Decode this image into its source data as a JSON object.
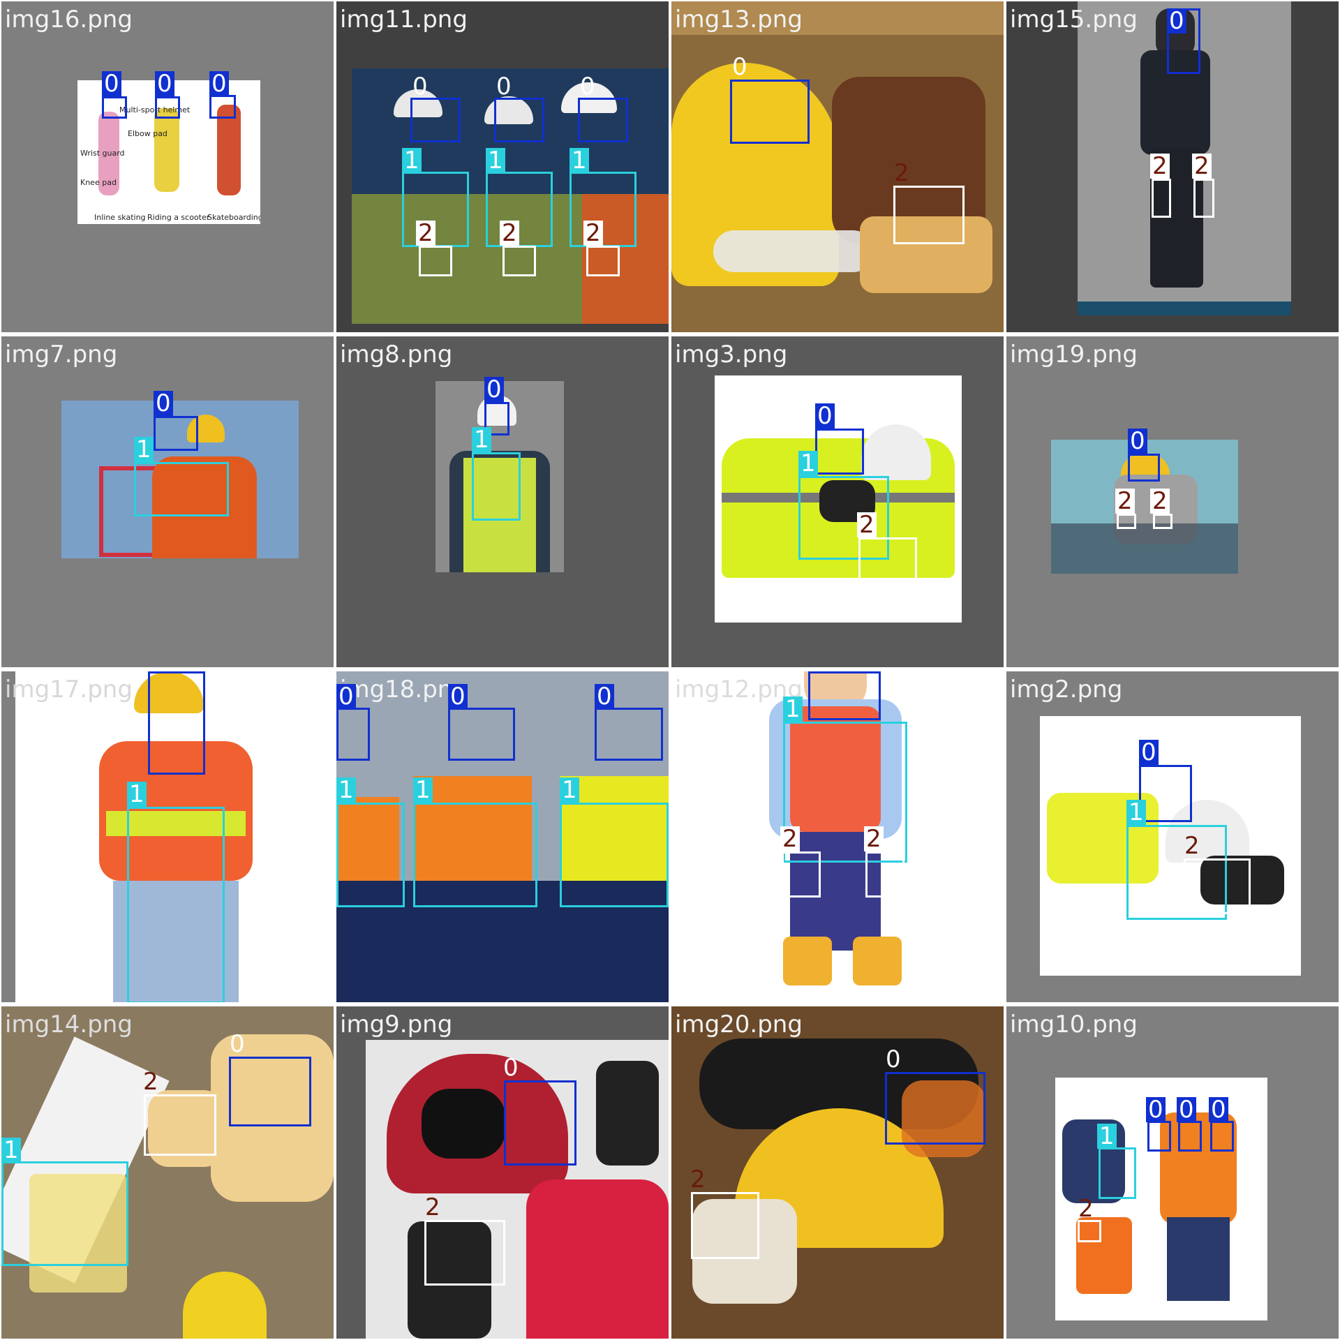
{
  "grid_bg": "#ffffff",
  "class_colors": {
    "0": "#1030d0",
    "1": "#2ad0de",
    "2": "#ffffff"
  },
  "tiles": [
    {
      "file": "img16.png",
      "bg": "#7f7f7f",
      "photo_color": "#ffffff",
      "figure_labels": [
        "Multi-sport helmet",
        "Elbow pad",
        "Wrist guard",
        "Knee pad",
        "Inline skating",
        "Riding a scooter",
        "Skateboarding"
      ],
      "boxes": [
        {
          "cls": "0"
        },
        {
          "cls": "0"
        },
        {
          "cls": "0"
        }
      ]
    },
    {
      "file": "img11.png",
      "bg": "#404040",
      "photo_color": "#1f3a5c",
      "boxes": [
        {
          "cls": "0"
        },
        {
          "cls": "0"
        },
        {
          "cls": "0"
        },
        {
          "cls": "1"
        },
        {
          "cls": "1"
        },
        {
          "cls": "1"
        },
        {
          "cls": "2"
        },
        {
          "cls": "2"
        },
        {
          "cls": "2"
        }
      ]
    },
    {
      "file": "img13.png",
      "bg": "#b08a50",
      "photo_color": "#8a6a3a",
      "boxes": [
        {
          "cls": "0"
        },
        {
          "cls": "2"
        }
      ]
    },
    {
      "file": "img15.png",
      "bg": "#404040",
      "photo_color": "#9a9a9a",
      "boxes": [
        {
          "cls": "0"
        },
        {
          "cls": "2"
        },
        {
          "cls": "2"
        }
      ]
    },
    {
      "file": "img7.png",
      "bg": "#7f7f7f",
      "photo_color": "#7aa0c8",
      "boxes": [
        {
          "cls": "0"
        },
        {
          "cls": "1"
        }
      ]
    },
    {
      "file": "img8.png",
      "bg": "#5a5a5a",
      "photo_color": "#8c8c8c",
      "boxes": [
        {
          "cls": "0"
        },
        {
          "cls": "1"
        }
      ]
    },
    {
      "file": "img3.png",
      "bg": "#5a5a5a",
      "photo_color": "#ffffff",
      "boxes": [
        {
          "cls": "0"
        },
        {
          "cls": "1"
        },
        {
          "cls": "2"
        }
      ]
    },
    {
      "file": "img19.png",
      "bg": "#7f7f7f",
      "photo_color": "#7fb8c4",
      "boxes": [
        {
          "cls": "0"
        },
        {
          "cls": "2"
        },
        {
          "cls": "2"
        }
      ]
    },
    {
      "file": "img17.png",
      "bg": "#808080",
      "photo_color": "#ffffff",
      "boxes": [
        {
          "cls": "0"
        },
        {
          "cls": "1"
        }
      ]
    },
    {
      "file": "img18.png",
      "bg": "#9aa6b4",
      "photo_color": "#9aa6b4",
      "boxes": [
        {
          "cls": "0"
        },
        {
          "cls": "0"
        },
        {
          "cls": "0"
        },
        {
          "cls": "1"
        },
        {
          "cls": "1"
        },
        {
          "cls": "1"
        }
      ]
    },
    {
      "file": "img12.png",
      "bg": "#ffffff",
      "photo_color": "#ffffff",
      "boxes": [
        {
          "cls": "0"
        },
        {
          "cls": "1"
        },
        {
          "cls": "2"
        },
        {
          "cls": "2"
        }
      ]
    },
    {
      "file": "img2.png",
      "bg": "#7f7f7f",
      "photo_color": "#ffffff",
      "boxes": [
        {
          "cls": "0"
        },
        {
          "cls": "1"
        },
        {
          "cls": "2"
        }
      ]
    },
    {
      "file": "img14.png",
      "bg": "#8a7a60",
      "photo_color": "#8a7a60",
      "boxes": [
        {
          "cls": "0"
        },
        {
          "cls": "1"
        },
        {
          "cls": "2"
        }
      ]
    },
    {
      "file": "img9.png",
      "bg": "#5a5a5a",
      "photo_color": "#e6e6e6",
      "boxes": [
        {
          "cls": "0"
        },
        {
          "cls": "2"
        }
      ]
    },
    {
      "file": "img20.png",
      "bg": "#6a4a2a",
      "photo_color": "#6a4a2a",
      "boxes": [
        {
          "cls": "0"
        },
        {
          "cls": "2"
        }
      ]
    },
    {
      "file": "img10.png",
      "bg": "#7f7f7f",
      "photo_color": "#ffffff",
      "boxes": [
        {
          "cls": "0"
        },
        {
          "cls": "0"
        },
        {
          "cls": "0"
        },
        {
          "cls": "1"
        },
        {
          "cls": "2"
        }
      ]
    }
  ]
}
